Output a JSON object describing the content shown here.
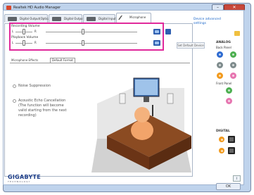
{
  "window": {
    "title": "Realtek HD Audio Manager"
  },
  "tabs": [
    {
      "label": "Digital Output(Optical)"
    },
    {
      "label": "Digital Output"
    },
    {
      "label": "Digital Input"
    },
    {
      "label": "Microphone",
      "active": true
    }
  ],
  "recording_volume": {
    "label": "Recording Volume",
    "left": "L",
    "right": "R"
  },
  "playback_volume": {
    "label": "Playback Volume",
    "left": "L",
    "right": "R"
  },
  "buttons": {
    "set_default": "Set Default Device",
    "ok": "OK"
  },
  "effects": {
    "label": "Microphone Effects",
    "subtab": "Default Format",
    "options": [
      {
        "text": "Noise Suppression"
      },
      {
        "lines": [
          "Acoustic Echo Cancellation",
          "(The function will become",
          "valid starting from the next",
          "recording)"
        ]
      }
    ]
  },
  "right_panel": {
    "link_lines": [
      "Device advanced",
      "settings"
    ],
    "analog": "ANALOG",
    "back_panel": "Back Panel",
    "front_panel": "Front Panel",
    "digital": "DIGITAL"
  },
  "branding": {
    "logo": "GIGABYTE",
    "tagline": "TECHNOLOGY"
  },
  "colors": {
    "highlight": "#e0299b",
    "link": "#1b66c9",
    "jack_blue": "#2e6bd1",
    "jack_green": "#4caf50",
    "jack_pink": "#e675b0",
    "jack_orange": "#f29a1d",
    "jack_gray": "#7f8c8d"
  }
}
